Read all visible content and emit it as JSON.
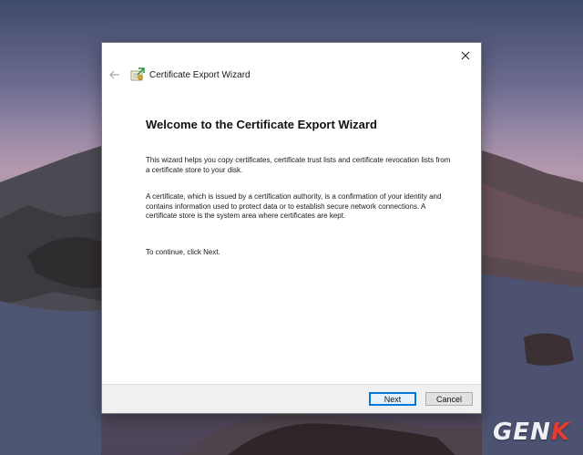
{
  "wizard": {
    "title": "Certificate Export Wizard",
    "heading": "Welcome to the Certificate Export Wizard",
    "paragraphs": [
      "This wizard helps you copy certificates, certificate trust lists and certificate revocation lists from a certificate store to your disk.",
      "A certificate, which is issued by a certification authority, is a confirmation of your identity and contains information used to protect data or to establish secure network connections. A certificate store is the system area where certificates are kept."
    ],
    "continue_text": "To continue, click Next.",
    "buttons": {
      "next": "Next",
      "cancel": "Cancel"
    }
  },
  "watermark": {
    "prefix": "GEN",
    "suffix": "K"
  },
  "icons": {
    "close": "close-icon",
    "back": "back-arrow-icon",
    "certificate": "certificate-icon"
  },
  "colors": {
    "accent": "#0078d7",
    "watermark_accent": "#e33b2f"
  }
}
